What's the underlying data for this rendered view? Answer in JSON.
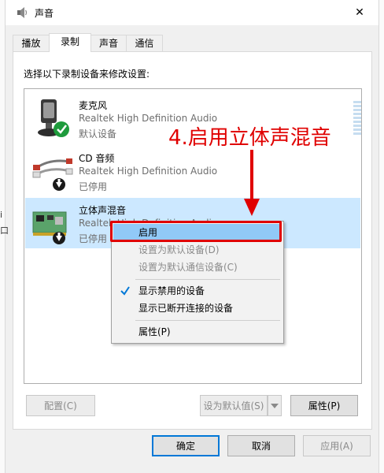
{
  "window": {
    "title": "声音",
    "close_glyph": "✕",
    "edge_text": [
      "i",
      "口"
    ]
  },
  "tabs": [
    {
      "label": "播放",
      "active": false
    },
    {
      "label": "录制",
      "active": true
    },
    {
      "label": "声音",
      "active": false
    },
    {
      "label": "通信",
      "active": false
    }
  ],
  "panel": {
    "instruction": "选择以下录制设备来修改设置:"
  },
  "devices": [
    {
      "name": "麦克风",
      "description": "Realtek High Definition Audio",
      "status": "默认设备",
      "icon": "microphone-icon",
      "badge": "default-check-icon"
    },
    {
      "name": "CD 音频",
      "description": "Realtek High Definition Audio",
      "status": "已停用",
      "icon": "cd-audio-cable-icon",
      "badge": "disabled-arrow-icon"
    },
    {
      "name": "立体声混音",
      "description": "Realtek High Definition Audio",
      "status": "已停用",
      "icon": "sound-card-icon",
      "badge": "disabled-arrow-icon",
      "selected": true
    }
  ],
  "annotation": {
    "text": "4.启用立体声混音",
    "color": "#e00000"
  },
  "context_menu": {
    "items": [
      {
        "label": "启用",
        "disabled": false,
        "highlight": true
      },
      {
        "label": "设置为默认设备(D)",
        "disabled": true
      },
      {
        "label": "设置为默认通信设备(C)",
        "disabled": true
      },
      {
        "label": "显示禁用的设备",
        "checked": true
      },
      {
        "label": "显示已断开连接的设备"
      },
      {
        "label": "属性(P)"
      }
    ]
  },
  "panel_buttons": {
    "configure": "配置(C)",
    "set_default": "设为默认值(S)",
    "properties": "属性(P)"
  },
  "dialog_buttons": {
    "ok": "确定",
    "cancel": "取消",
    "apply": "应用(A)"
  },
  "colors": {
    "selection": "#cce8ff",
    "menu_highlight": "#91c9f7",
    "accent": "#0078d7"
  }
}
